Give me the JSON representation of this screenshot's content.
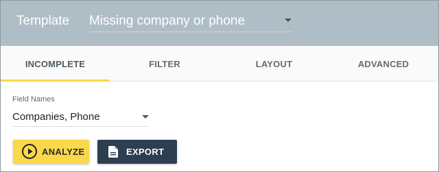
{
  "header": {
    "title": "Template",
    "template_select": {
      "value": "Missing company or phone",
      "icon": "chevron-down-icon"
    }
  },
  "tabs": [
    {
      "label": "INCOMPLETE",
      "active": true
    },
    {
      "label": "FILTER",
      "active": false
    },
    {
      "label": "LAYOUT",
      "active": false
    },
    {
      "label": "ADVANCED",
      "active": false
    }
  ],
  "form": {
    "field_names_label": "Field Names",
    "field_names_value": "Companies, Phone"
  },
  "actions": {
    "analyze_label": "ANALYZE",
    "analyze_icon": "play-circle-icon",
    "export_label": "EXPORT",
    "export_icon": "document-icon"
  },
  "colors": {
    "header_bg": "#afbec6",
    "accent_yellow": "#f9d84a",
    "export_bg": "#2c3e50"
  }
}
